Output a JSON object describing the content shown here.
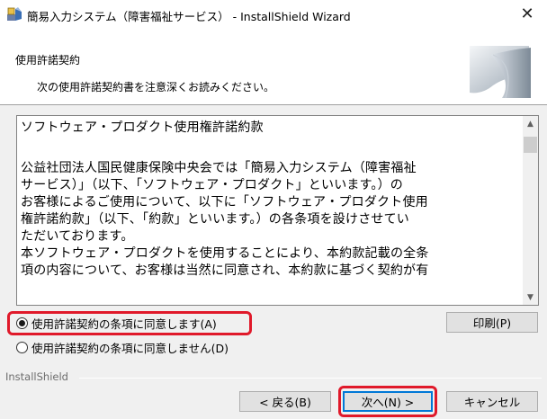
{
  "window": {
    "title": "簡易入力システム（障害福祉サービス） - InstallShield Wizard",
    "close_glyph": "✕"
  },
  "header": {
    "title": "使用許諾契約",
    "subtitle": "次の使用許諾契約書を注意深くお読みください。"
  },
  "license": {
    "heading": "ソフトウェア・プロダクト使用権許諾約款",
    "para1_lines": [
      "公益社団法人国民健康保険中央会では「簡易入力システム（障害福祉",
      "サービス）」（以下、「ソフトウェア・プロダクト」といいます。）の",
      "お客様によるご使用について、以下に「ソフトウェア・プロダクト使用",
      "権許諾約款」（以下、「約款」といいます。）の各条項を設けさせてい",
      "ただいております。"
    ],
    "para2_lines": [
      "本ソフトウェア・プロダクトを使用することにより、本約款記載の全条",
      "項の内容について、お客様は当然に同意され、本約款に基づく契約が有"
    ]
  },
  "options": {
    "accept_label": "使用許諾契約の条項に同意します(A)",
    "decline_label": "使用許諾契約の条項に同意しません(D)",
    "selected": "accept"
  },
  "buttons": {
    "print": "印刷(P)",
    "back": "< 戻る(B)",
    "next": "次へ(N) >",
    "cancel": "キャンセル"
  },
  "footer": {
    "brand": "InstallShield"
  },
  "colors": {
    "highlight": "#e0192a",
    "default_button_border": "#0078d7"
  }
}
